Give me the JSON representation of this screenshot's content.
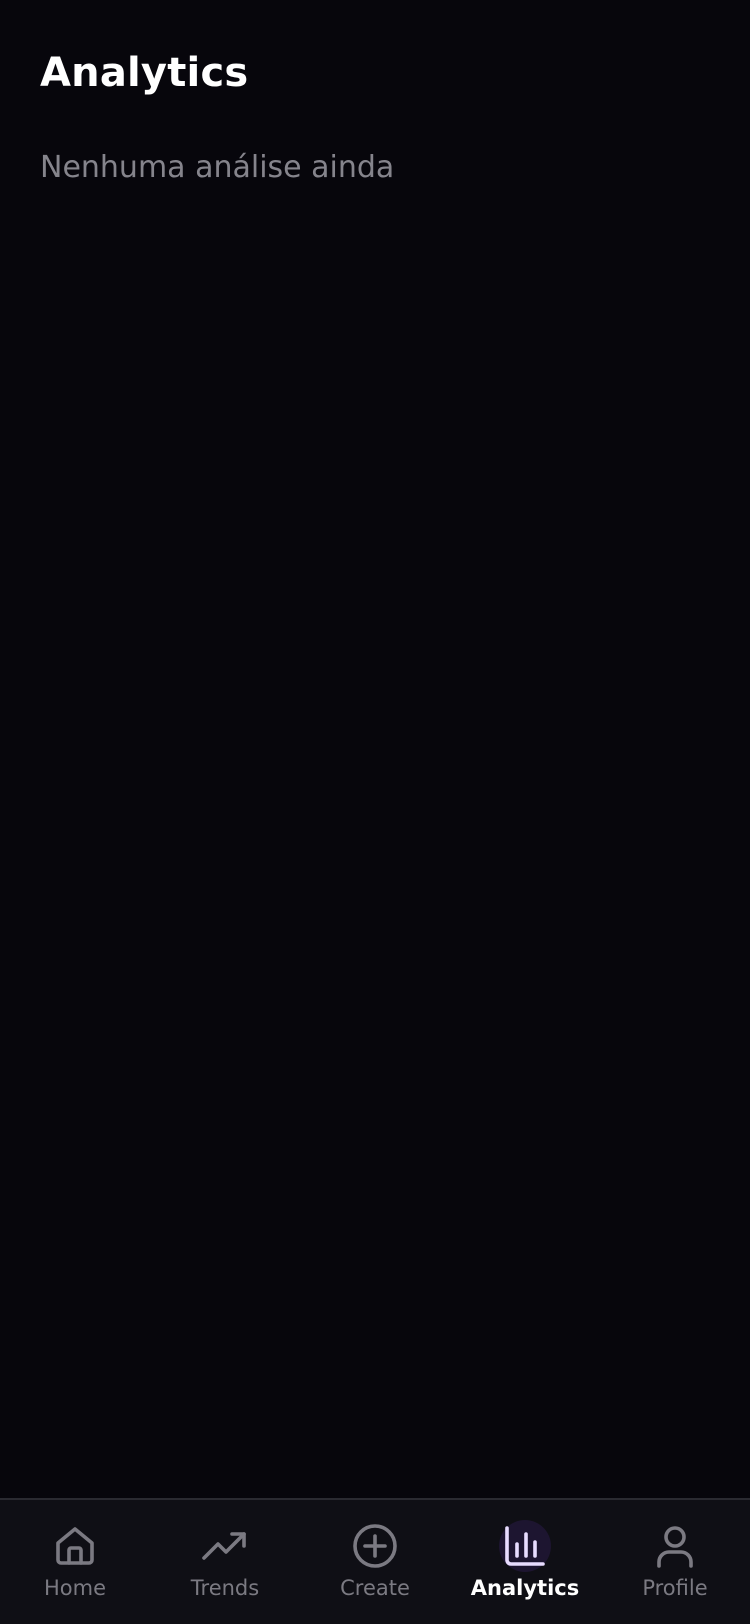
{
  "header": {
    "title": "Analytics"
  },
  "main": {
    "empty_message": "Nenhuma análise ainda"
  },
  "tabbar": {
    "active": "analytics",
    "items": [
      {
        "id": "home",
        "label": "Home",
        "icon": "home-icon"
      },
      {
        "id": "trends",
        "label": "Trends",
        "icon": "trending-up-icon"
      },
      {
        "id": "create",
        "label": "Create",
        "icon": "plus-circle-icon"
      },
      {
        "id": "analytics",
        "label": "Analytics",
        "icon": "bar-chart-icon"
      },
      {
        "id": "profile",
        "label": "Profile",
        "icon": "user-icon"
      }
    ]
  },
  "colors": {
    "background": "#07060c",
    "tabbar_background": "#0f0f15",
    "inactive": "#7b7a82",
    "active_icon": "#e8dcff",
    "active_icon_bg": "#1d1530"
  }
}
